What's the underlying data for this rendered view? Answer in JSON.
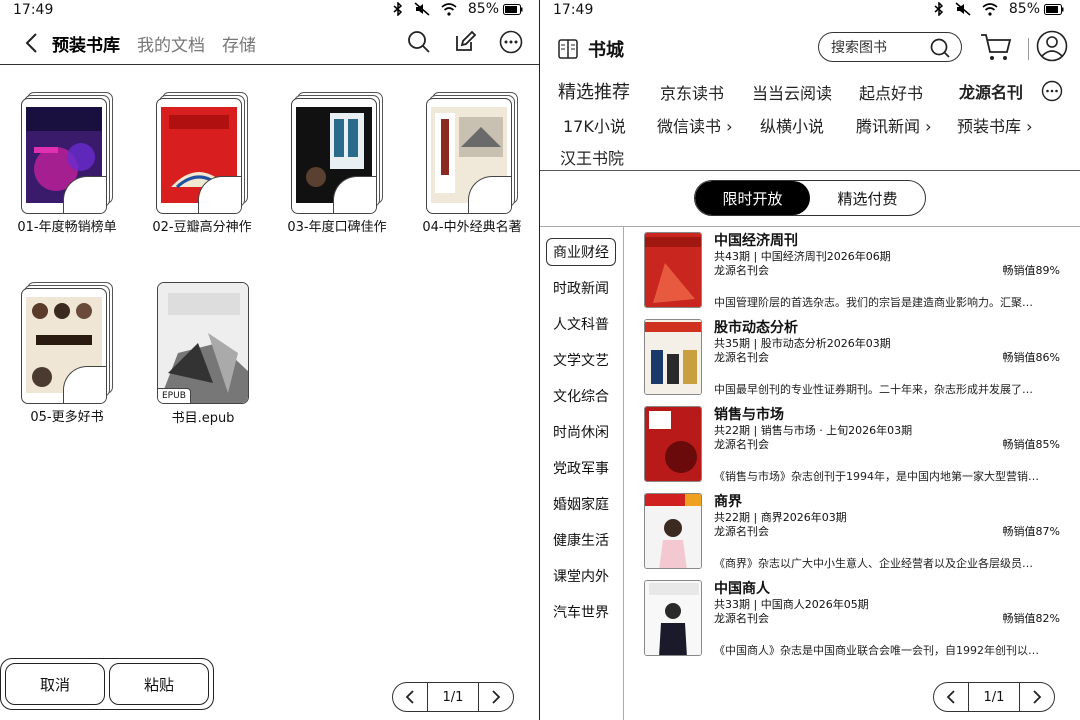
{
  "status": {
    "time": "17:49",
    "battery": "85%"
  },
  "left": {
    "tabs": [
      "预装书库",
      "我的文档",
      "存储"
    ],
    "folders": [
      {
        "name": "01-年度畅销榜单"
      },
      {
        "name": "02-豆瓣高分神作"
      },
      {
        "name": "03-年度口碑佳作"
      },
      {
        "name": "04-中外经典名著"
      },
      {
        "name": "05-更多好书"
      }
    ],
    "epub": {
      "name": "书目.epub",
      "tag": "EPUB"
    },
    "cancel": "取消",
    "paste": "粘贴",
    "page": "1/1"
  },
  "right": {
    "title": "书城",
    "search_placeholder": "搜索图书",
    "categories": {
      "featured": "精选推荐",
      "jd": "京东读书",
      "dangdang": "当当云阅读",
      "qidian": "起点好书",
      "longyuan": "龙源名刊",
      "k17": "17K小说",
      "weixin": "微信读书",
      "zongheng": "纵横小说",
      "tencent": "腾讯新闻",
      "preinstalled": "预装书库",
      "hanwang": "汉王书院"
    },
    "segments": [
      "限时开放",
      "精选付费"
    ],
    "sidebar": [
      "商业财经",
      "时政新闻",
      "人文科普",
      "文学文艺",
      "文化综合",
      "时尚休闲",
      "党政军事",
      "婚姻家庭",
      "健康生活",
      "课堂内外",
      "汽车世界"
    ],
    "magazines": [
      {
        "title": "中国经济周刊",
        "sub": "共43期 | 中国经济周刊2026年06期",
        "publisher": "龙源名刊会",
        "value": "畅销值89%",
        "desc": "中国管理阶层的首选杂志。我们的宗旨是建造商业影响力。汇聚…"
      },
      {
        "title": "股市动态分析",
        "sub": "共35期 | 股市动态分析2026年03期",
        "publisher": "龙源名刊会",
        "value": "畅销值86%",
        "desc": "中国最早创刊的专业性证券期刊。二十年来，杂志形成并发展了…"
      },
      {
        "title": "销售与市场",
        "sub": "共22期 | 销售与市场 · 上旬2026年03期",
        "publisher": "龙源名刊会",
        "value": "畅销值85%",
        "desc": "《销售与市场》杂志创刊于1994年，是中国内地第一家大型营销…"
      },
      {
        "title": "商界",
        "sub": "共22期 | 商界2026年03期",
        "publisher": "龙源名刊会",
        "value": "畅销值87%",
        "desc": "《商界》杂志以广大中小生意人、企业经营者以及企业各层级员…"
      },
      {
        "title": "中国商人",
        "sub": "共33期 | 中国商人2026年05期",
        "publisher": "龙源名刊会",
        "value": "畅销值82%",
        "desc": "《中国商人》杂志是中国商业联合会唯一会刊，自1992年创刊以…"
      }
    ],
    "page": "1/1"
  }
}
